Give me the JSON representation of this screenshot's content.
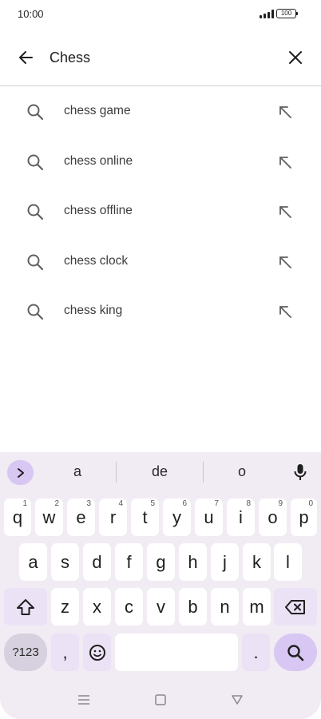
{
  "status_bar": {
    "time": "10:00",
    "battery": "100",
    "icons": [
      "signal-icon",
      "battery-icon"
    ]
  },
  "search": {
    "query": "Chess",
    "back_icon": "arrow-left-icon",
    "clear_icon": "close-icon"
  },
  "suggestions": [
    {
      "label": "chess game"
    },
    {
      "label": "chess online"
    },
    {
      "label": "chess offline"
    },
    {
      "label": "chess clock"
    },
    {
      "label": "chess king"
    }
  ],
  "keyboard": {
    "suggestions": [
      "a",
      "de",
      "o"
    ],
    "row1": [
      {
        "key": "q",
        "hint": "1"
      },
      {
        "key": "w",
        "hint": "2"
      },
      {
        "key": "e",
        "hint": "3"
      },
      {
        "key": "r",
        "hint": "4"
      },
      {
        "key": "t",
        "hint": "5"
      },
      {
        "key": "y",
        "hint": "6"
      },
      {
        "key": "u",
        "hint": "7"
      },
      {
        "key": "i",
        "hint": "8"
      },
      {
        "key": "o",
        "hint": "9"
      },
      {
        "key": "p",
        "hint": "0"
      }
    ],
    "row2": [
      "a",
      "s",
      "d",
      "f",
      "g",
      "h",
      "j",
      "k",
      "l"
    ],
    "row3": [
      "z",
      "x",
      "c",
      "v",
      "b",
      "n",
      "m"
    ],
    "symbols_label": "?123",
    "comma": ",",
    "period": "."
  },
  "colors": {
    "accent": "#d8c7f3",
    "keyboard_bg": "#f1ebf3",
    "key_bg": "#ffffff"
  }
}
